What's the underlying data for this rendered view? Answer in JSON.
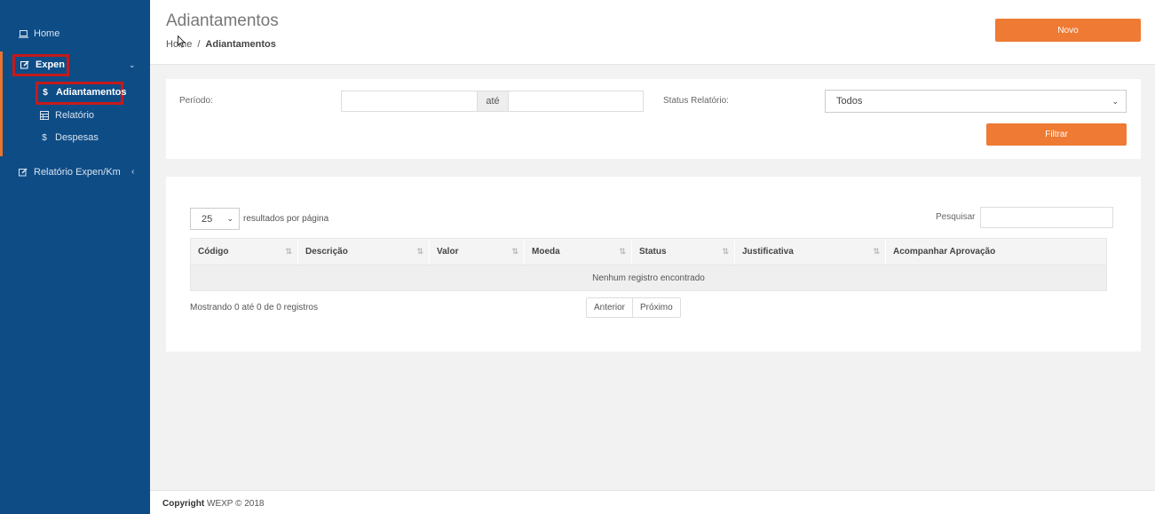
{
  "sidebar": {
    "home": "Home",
    "expen": "Expen",
    "adiantamentos": "Adiantamentos",
    "relatorio": "Relatório",
    "despesas": "Despesas",
    "relatorio_km": "Relatório Expen/Km"
  },
  "header": {
    "title": "Adiantamentos",
    "breadcrumb_home": "Home",
    "breadcrumb_sep": "/",
    "breadcrumb_current": "Adiantamentos",
    "novo_label": "Novo"
  },
  "filter": {
    "periodo_label": "Período:",
    "periodo_start": "",
    "ate_label": "até",
    "periodo_end": "",
    "status_label": "Status Relatório:",
    "status_value": "Todos",
    "filtrar_label": "Filtrar"
  },
  "table": {
    "page_length": "25",
    "page_length_label": "resultados por página",
    "search_label": "Pesquisar",
    "search_value": "",
    "columns": [
      "Código",
      "Descrição",
      "Valor",
      "Moeda",
      "Status",
      "Justificativa",
      "Acompanhar Aprovação"
    ],
    "empty_message": "Nenhum registro encontrado",
    "info": "Mostrando 0 até 0 de 0 registros",
    "prev_label": "Anterior",
    "next_label": "Próximo"
  },
  "footer": {
    "copyright_bold": "Copyright",
    "copyright_text": "WEXP © 2018"
  },
  "colors": {
    "sidebar_bg": "#0e4c86",
    "accent_orange": "#ee7a33",
    "highlight_red": "#c51a1a"
  },
  "icons": [
    "laptop-icon",
    "edit-icon",
    "dollar-icon",
    "table-icon",
    "chevron-down-icon",
    "chevron-left-icon",
    "sort-icon"
  ]
}
